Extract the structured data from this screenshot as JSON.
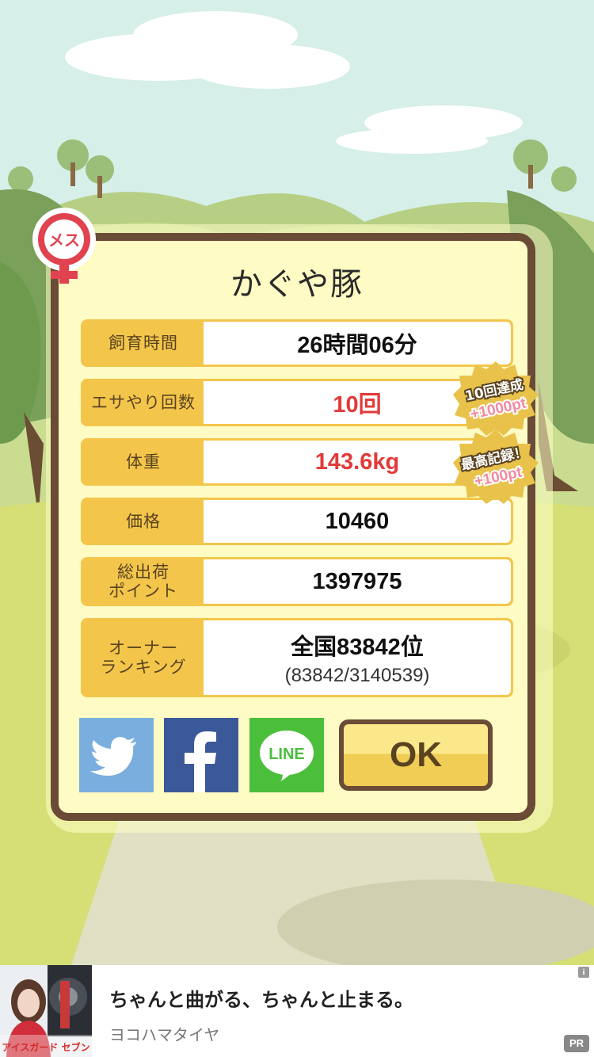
{
  "pig": {
    "name": "かぐや豚",
    "gender_badge": "メス"
  },
  "stats": [
    {
      "label": "飼育時間",
      "value": "26時間06分",
      "highlight": false
    },
    {
      "label": "エサやり回数",
      "value": "10回",
      "highlight": true
    },
    {
      "label": "体重",
      "value": "143.6kg",
      "highlight": true
    },
    {
      "label": "価格",
      "value": "10460",
      "highlight": false
    },
    {
      "label": "総出荷\nポイント",
      "value": "1397975",
      "highlight": false
    },
    {
      "label": "オーナー\nランキング",
      "value": "全国83842位",
      "sub": "(83842/3140539)",
      "highlight": false
    }
  ],
  "badges": [
    {
      "line1": "10回達成",
      "line2": "+1000pt"
    },
    {
      "line1": "最高記録！",
      "line2": "+100pt"
    }
  ],
  "share": {
    "twitter": "twitter-icon",
    "facebook": "facebook-icon",
    "line": "LINE"
  },
  "ok_label": "OK",
  "ad": {
    "headline": "ちゃんと曲がる、ちゃんと止まる。",
    "advertiser": "ヨコハマタイヤ",
    "info": "i",
    "pr": "PR",
    "thumb_text": "アイスガード セブン"
  },
  "colors": {
    "frame": "#6a4b36",
    "panel": "#fffbc4",
    "label_bg": "#f3c64b",
    "highlight_text": "#e23a3a",
    "twitter": "#7aaede",
    "facebook": "#3b5998",
    "line": "#4bbf3c"
  }
}
